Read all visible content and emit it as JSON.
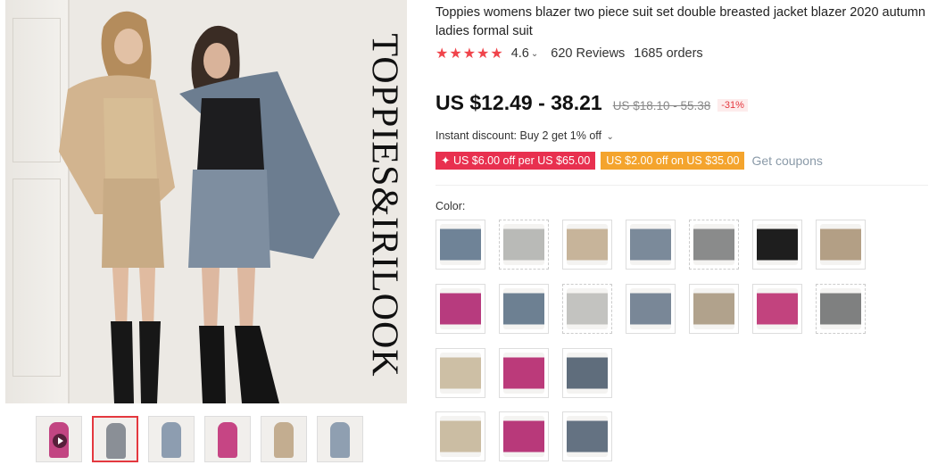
{
  "product": {
    "title": "Toppies womens blazer two piece suit set double breasted jacket blazer 2020 autumn ladies formal suit",
    "brand_watermark": "TOPPIES&IRILOOK",
    "rating": {
      "stars": "★★★★★",
      "score": "4.6",
      "reviews": "620 Reviews",
      "orders": "1685 orders"
    },
    "price": {
      "current": "US $12.49 - 38.21",
      "original": "US $18.10 - 55.38",
      "discount": "-31%"
    },
    "instant_discount": "Instant discount: Buy 2 get 1% off",
    "coupons": [
      {
        "label": "✦ US $6.00 off per US $65.00"
      },
      {
        "label": "US $2.00 off on US $35.00"
      }
    ],
    "get_coupons": "Get coupons",
    "color_label": "Color:",
    "colors": [
      {
        "name": "swatch-blue-grey-set",
        "color": "#6f8397"
      },
      {
        "name": "swatch-light-grey-set",
        "color": "#b9bab7"
      },
      {
        "name": "swatch-beige-set",
        "color": "#c7b49a"
      },
      {
        "name": "swatch-blue-grey-set-2",
        "color": "#7b8a9a"
      },
      {
        "name": "swatch-grey-blazer",
        "color": "#8a8b8b"
      },
      {
        "name": "swatch-black-set",
        "color": "#1e1e1e"
      },
      {
        "name": "swatch-khaki-set",
        "color": "#b39f85"
      },
      {
        "name": "swatch-magenta-set",
        "color": "#b73b7e"
      },
      {
        "name": "swatch-blue-skirt-set",
        "color": "#6d8092"
      },
      {
        "name": "swatch-light-grey-2",
        "color": "#c3c3c0"
      },
      {
        "name": "swatch-blue-grey-3",
        "color": "#798797"
      },
      {
        "name": "swatch-khaki-2",
        "color": "#b1a28c"
      },
      {
        "name": "swatch-magenta-2",
        "color": "#c2437e"
      },
      {
        "name": "swatch-grey-skirt",
        "color": "#7f8080"
      },
      {
        "name": "swatch-beige-skirt",
        "color": "#cdbfa5"
      },
      {
        "name": "swatch-magenta-skirt",
        "color": "#bb3a7a"
      },
      {
        "name": "swatch-blue-skirt",
        "color": "#5f6d7c"
      },
      {
        "name": "swatch-beige-skirt-2",
        "color": "#cbbda3"
      },
      {
        "name": "swatch-magenta-skirt-2",
        "color": "#b8397a"
      },
      {
        "name": "swatch-blue-skirt-2",
        "color": "#647282"
      }
    ],
    "thumbnails": [
      {
        "color": "#c24582",
        "video": true
      },
      {
        "color": "#8a8f96",
        "active": true
      },
      {
        "color": "#8d9db0"
      },
      {
        "color": "#c64584"
      },
      {
        "color": "#c3ad90"
      },
      {
        "color": "#8f9fb1"
      }
    ]
  }
}
